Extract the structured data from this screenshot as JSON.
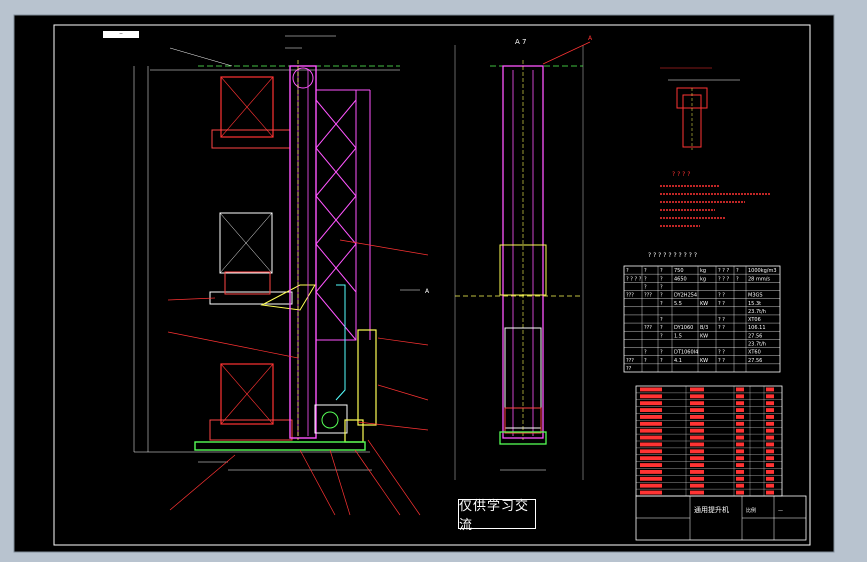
{
  "watermark": "仅供学习交流",
  "sheet_tag": "—",
  "view_labels": {
    "section_a": "A 7",
    "a_mark": "A",
    "arrow_a": "A"
  },
  "tech_title": "? ? ? ?",
  "param_title": "? ? ? ? ? ? ? ? ? ?",
  "param_rows": [
    [
      "?",
      "?",
      "?",
      "750",
      "kg",
      "? ? ?",
      "?",
      "1000kg/m3"
    ],
    [
      "? ? ? ?",
      "?",
      "?",
      "4650",
      "kg",
      "? ? ?",
      "?",
      "28 mm/s"
    ],
    [
      "",
      "?",
      "?",
      "",
      "",
      "",
      "",
      ""
    ],
    [
      "???",
      "???",
      "?",
      "DY2H254",
      "",
      "? ?",
      "",
      "M3GS"
    ],
    [
      "",
      "",
      "?",
      "5.5",
      "KW",
      "? ?",
      "",
      "15.3t"
    ],
    [
      "",
      "",
      "",
      "",
      "",
      "",
      "",
      "23.7t/h"
    ],
    [
      "",
      "",
      "?",
      "",
      "",
      "? ?",
      "",
      "XT06"
    ],
    [
      "",
      "???",
      "?",
      "DY1060",
      "B/3",
      "? ?",
      "",
      "106.11"
    ],
    [
      "",
      "",
      "?",
      "1.5",
      "KW",
      "",
      "",
      "27.56"
    ],
    [
      "",
      "",
      "",
      "",
      "",
      "",
      "",
      "23.7t/h"
    ],
    [
      "",
      "?",
      "?",
      "DT1060I4",
      "",
      "? ?",
      "",
      "XT60"
    ],
    [
      "???",
      "?",
      "?",
      "4.1",
      "KW",
      "? ?",
      "",
      "27.56"
    ],
    [
      "??",
      "",
      "",
      "",
      "",
      "",
      "",
      ""
    ]
  ],
  "title_block": {
    "name": "通用提升机",
    "scale": "比例",
    "sheet": "—"
  }
}
